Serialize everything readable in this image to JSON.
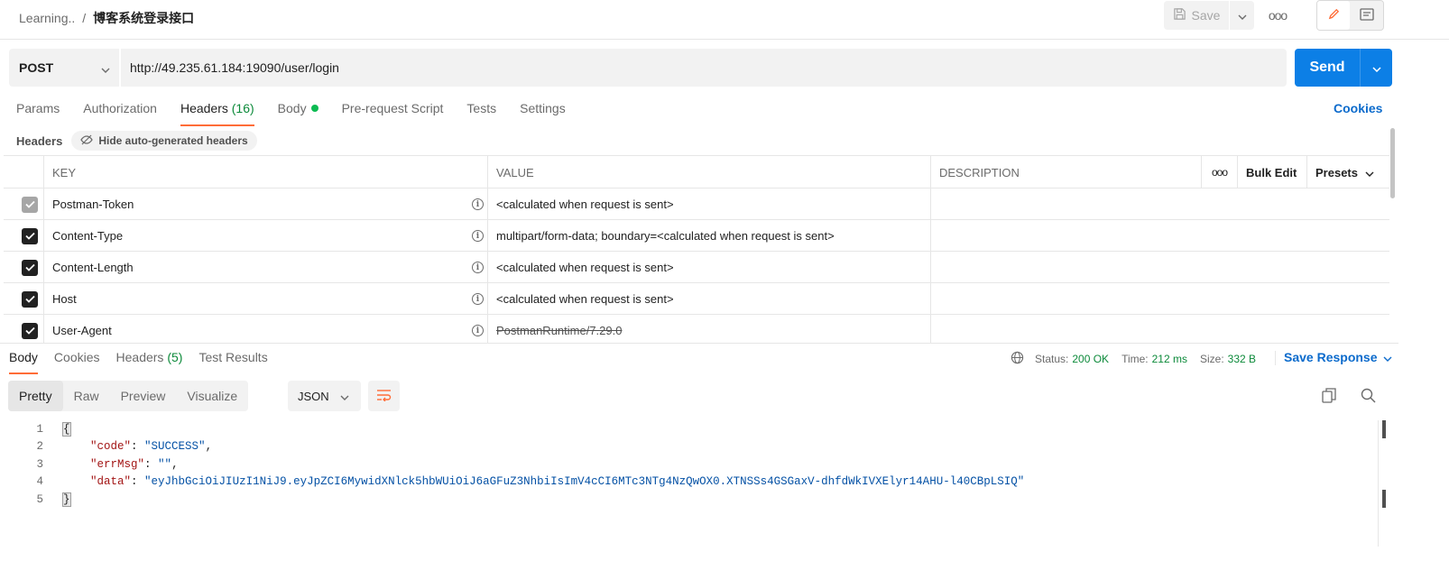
{
  "breadcrumb": {
    "parent": "Learning..",
    "separator": "/",
    "current": "博客系统登录接口"
  },
  "toolbar": {
    "save_label": "Save",
    "more": "ooo"
  },
  "request": {
    "method": "POST",
    "url": "http://49.235.61.184:19090/user/login",
    "send_label": "Send"
  },
  "req_tabs": [
    {
      "label": "Params"
    },
    {
      "label": "Authorization"
    },
    {
      "label": "Headers",
      "count": "(16)"
    },
    {
      "label": "Body"
    },
    {
      "label": "Pre-request Script"
    },
    {
      "label": "Tests"
    },
    {
      "label": "Settings"
    }
  ],
  "cookies_label": "Cookies",
  "headers_section": {
    "label": "Headers",
    "hide_label": "Hide auto-generated headers"
  },
  "table": {
    "columns": {
      "key": "KEY",
      "value": "VALUE",
      "description": "DESCRIPTION",
      "more": "ooo",
      "bulk_edit": "Bulk Edit",
      "presets": "Presets"
    },
    "rows": [
      {
        "key": "Postman-Token",
        "value": "<calculated when request is sent>",
        "checked": true,
        "disabled": true
      },
      {
        "key": "Content-Type",
        "value": "multipart/form-data; boundary=<calculated when request is sent>",
        "checked": true
      },
      {
        "key": "Content-Length",
        "value": "<calculated when request is sent>",
        "checked": true
      },
      {
        "key": "Host",
        "value": "<calculated when request is sent>",
        "checked": true
      },
      {
        "key": "User-Agent",
        "value": "PostmanRuntime/7.29.0",
        "checked": true,
        "struck": true
      }
    ]
  },
  "response": {
    "tabs": [
      {
        "label": "Body"
      },
      {
        "label": "Cookies"
      },
      {
        "label": "Headers",
        "count": "(5)"
      },
      {
        "label": "Test Results"
      }
    ],
    "status_label": "Status:",
    "status_value": "200 OK",
    "time_label": "Time:",
    "time_value": "212 ms",
    "size_label": "Size:",
    "size_value": "332 B",
    "save_response": "Save Response",
    "formats": [
      "Pretty",
      "Raw",
      "Preview",
      "Visualize"
    ],
    "language": "JSON",
    "code": {
      "line_numbers": [
        "1",
        "2",
        "3",
        "4",
        "5"
      ],
      "open_brace": "{",
      "close_brace": "}",
      "fields": [
        {
          "key": "\"code\"",
          "value": "\"SUCCESS\"",
          "trail": ","
        },
        {
          "key": "\"errMsg\"",
          "value": "\"\"",
          "trail": ","
        },
        {
          "key": "\"data\"",
          "value": "\"eyJhbGciOiJIUzI1NiJ9.eyJpZCI6MywidXNlck5hbWUiOiJ6aGFuZ3NhbiIsImV4cCI6MTc3NTg4NzQwOX0.XTNSSs4GSGaxV-dhfdWkIVXElyr14AHU-l40CBpLSIQ\"",
          "trail": ""
        }
      ]
    }
  },
  "colors": {
    "accent": "#ff6c37",
    "primary": "#0c7fe6",
    "success": "#0c8a3a"
  }
}
